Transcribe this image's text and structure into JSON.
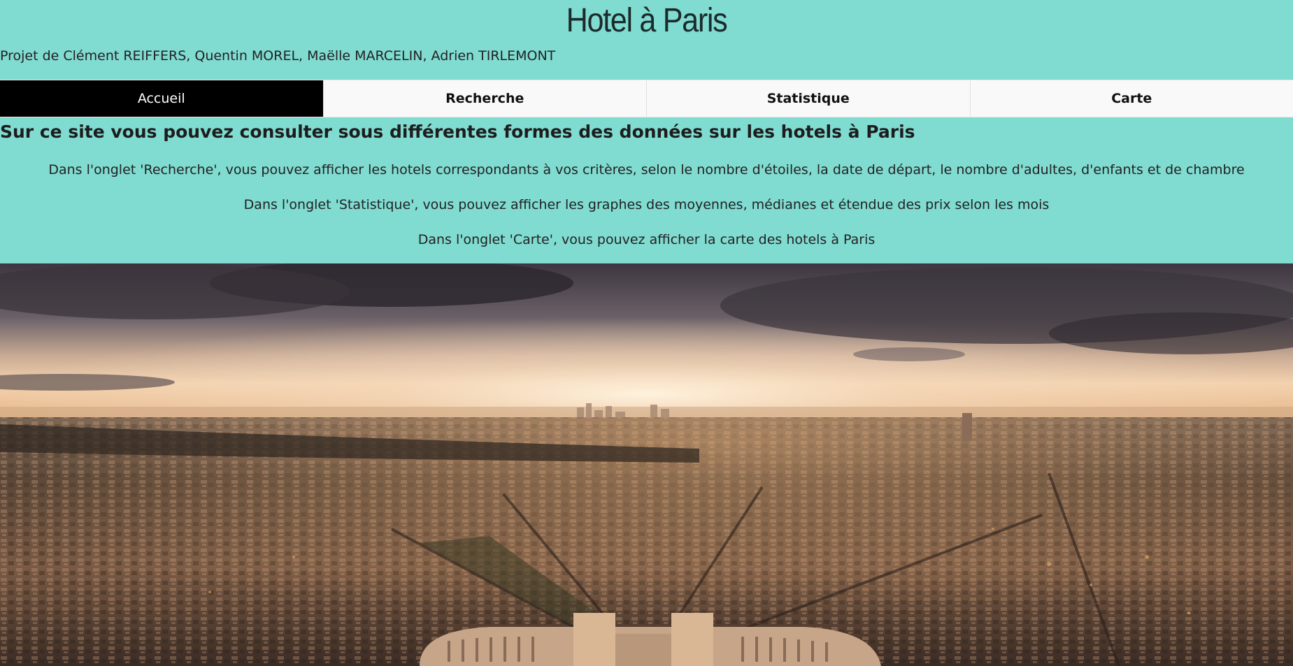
{
  "header": {
    "title": "Hotel à Paris",
    "authors": "Projet de Clément REIFFERS, Quentin MOREL, Maëlle MARCELIN, Adrien TIRLEMONT"
  },
  "nav": {
    "tabs": [
      {
        "label": "Accueil",
        "active": true
      },
      {
        "label": "Recherche",
        "active": false
      },
      {
        "label": "Statistique",
        "active": false
      },
      {
        "label": "Carte",
        "active": false
      }
    ]
  },
  "main": {
    "heading": "Sur ce site vous pouvez consulter sous différentes formes des données sur les hotels à Paris",
    "descriptions": [
      "Dans l'onglet 'Recherche', vous pouvez afficher les hotels correspondants à vos critères, selon le nombre d'étoiles, la date de départ, le nombre d'adultes, d'enfants et de chambre",
      "Dans l'onglet 'Statistique', vous pouvez afficher les graphes des moyennes, médianes et étendue des prix selon les mois",
      "Dans l'onglet 'Carte', vous pouvez afficher la carte des hotels à Paris"
    ]
  },
  "colors": {
    "background": "#80dbd1",
    "active_tab": "#000000",
    "tab_background": "#f9f9f9"
  },
  "hero_image": {
    "icon": "paris-panorama-image"
  }
}
